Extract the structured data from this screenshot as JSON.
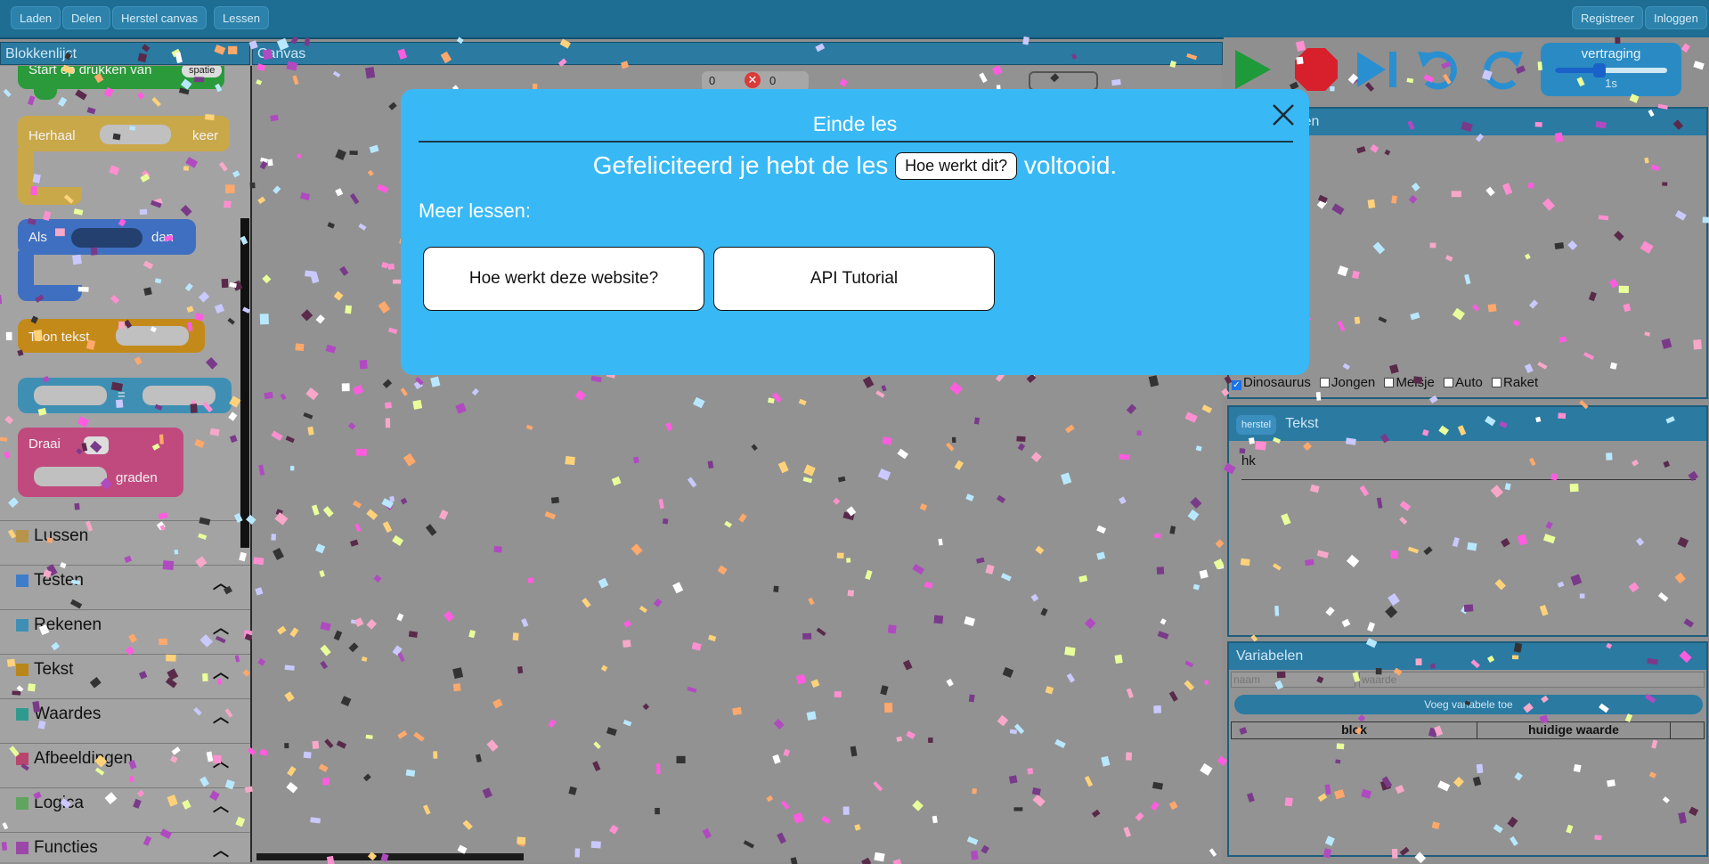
{
  "topbar": {
    "left_buttons": [
      "Laden",
      "Delen",
      "Herstel canvas",
      "Lessen"
    ],
    "right_buttons": [
      "Registreer",
      "Inloggen"
    ]
  },
  "panels": {
    "blocklist_title": "Blokkenlijst",
    "canvas_title": "Canvas"
  },
  "blocks": {
    "start_label": "Start op drukken van",
    "start_key": "spatie",
    "repeat_label": "Herhaal",
    "repeat_suffix": "keer",
    "if_label": "Als",
    "if_suffix": "dan",
    "show_text_label": "Toon tekst",
    "assign_op": "=",
    "turn_label": "Draai",
    "turn_suffix": "graden"
  },
  "categories": [
    {
      "label": "Lussen",
      "color": "#b8944a",
      "chevron": false
    },
    {
      "label": "Testen",
      "color": "#3f7cc9",
      "chevron": true
    },
    {
      "label": "Rekenen",
      "color": "#3f8fb4",
      "chevron": true
    },
    {
      "label": "Tekst",
      "color": "#b8861a",
      "chevron": true
    },
    {
      "label": "Waardes",
      "color": "#2f9a8e",
      "chevron": true
    },
    {
      "label": "Afbeeldingen",
      "color": "#b8456e",
      "chevron": true
    },
    {
      "label": "Logica",
      "color": "#5fa55f",
      "chevron": true
    },
    {
      "label": "Functies",
      "color": "#9a48a8",
      "chevron": true
    }
  ],
  "canvas_badges": {
    "left_count": "0",
    "right_count": "0"
  },
  "delay": {
    "label": "vertraging",
    "value": "1s",
    "fraction": 0.4
  },
  "images_section": {
    "title": "Afbeeldingen",
    "characters": [
      {
        "label": "Dinosaurus",
        "checked": true
      },
      {
        "label": "Jongen",
        "checked": false
      },
      {
        "label": "Meisje",
        "checked": false
      },
      {
        "label": "Auto",
        "checked": false
      },
      {
        "label": "Raket",
        "checked": false
      }
    ]
  },
  "text_section": {
    "reset_label": "herstel",
    "title": "Tekst",
    "content": "hk"
  },
  "variables_section": {
    "title": "Variabelen",
    "name_placeholder": "naam",
    "value_placeholder": "waarde",
    "add_label": "Voeg variabele toe",
    "col_block": "blok",
    "col_value": "huidige waarde"
  },
  "modal": {
    "title": "Einde les",
    "congrats_before": "Gefeliciteerd je hebt de les",
    "lesson_name": "Hoe werkt dit?",
    "congrats_after": "voltooid.",
    "more_lessons": "Meer lessen:",
    "lessons": [
      "Hoe werkt deze website?",
      "API Tutorial"
    ]
  },
  "colors": {
    "topbar": "#1e6d92",
    "modal": "#38b9f6",
    "canvas": "#929292",
    "start_block": "#2a9a3a",
    "repeat_block": "#c9a84a",
    "if_block": "#3f6fc0",
    "text_block": "#c38a1a",
    "assign_block": "#3f8fb4",
    "turn_block": "#c04a7e"
  }
}
